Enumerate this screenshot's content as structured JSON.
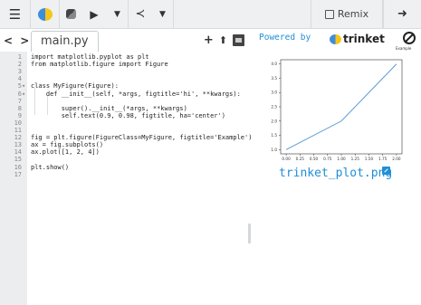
{
  "toolbar": {
    "menu_icon": "menu-icon",
    "run_icon": "run-icon",
    "remix_label": "Remix"
  },
  "editor": {
    "file_tab": "main.py",
    "nav_arrows": "< >",
    "lines": [
      {
        "n": "1",
        "fold": "",
        "code": "import matplotlib.pyplot as plt"
      },
      {
        "n": "2",
        "fold": "",
        "code": "from matplotlib.figure import Figure"
      },
      {
        "n": "3",
        "fold": "",
        "code": ""
      },
      {
        "n": "4",
        "fold": "",
        "code": ""
      },
      {
        "n": "5",
        "fold": "▾",
        "code": "class MyFigure(Figure):"
      },
      {
        "n": "6",
        "fold": "▾",
        "code": "    def __init__(self, *args, figtitle='hi', **kwargs):"
      },
      {
        "n": "7",
        "fold": "",
        "code": ""
      },
      {
        "n": "8",
        "fold": "",
        "code": "        super().__init__(*args, **kwargs)"
      },
      {
        "n": "9",
        "fold": "",
        "code": "        self.text(0.9, 0.98, figtitle, ha='center')"
      },
      {
        "n": "10",
        "fold": "",
        "code": ""
      },
      {
        "n": "11",
        "fold": "",
        "code": ""
      },
      {
        "n": "12",
        "fold": "",
        "code": "fig = plt.figure(FigureClass=MyFigure, figtitle='Example')"
      },
      {
        "n": "13",
        "fold": "",
        "code": "ax = fig.subplots()"
      },
      {
        "n": "14",
        "fold": "",
        "code": "ax.plot([1, 2, 4])"
      },
      {
        "n": "15",
        "fold": "",
        "code": ""
      },
      {
        "n": "16",
        "fold": "",
        "code": "plt.show()"
      },
      {
        "n": "17",
        "fold": "",
        "code": ""
      }
    ]
  },
  "output": {
    "powered_by": "Powered by",
    "brand": "trinket",
    "stop_label": "Example",
    "image_name": "trinket_plot.png"
  },
  "chart_data": {
    "type": "line",
    "x": [
      0,
      1,
      2
    ],
    "y": [
      1,
      2,
      4
    ],
    "xticks": [
      "0.00",
      "0.25",
      "0.50",
      "0.75",
      "1.00",
      "1.25",
      "1.50",
      "1.75",
      "2.00"
    ],
    "yticks": [
      "1.0",
      "1.5",
      "2.0",
      "2.5",
      "3.0",
      "3.5",
      "4.0"
    ],
    "xlim": [
      -0.1,
      2.1
    ],
    "ylim": [
      0.85,
      4.15
    ],
    "line_color": "#5b9bd5",
    "title": "",
    "xlabel": "",
    "ylabel": ""
  },
  "colors": {
    "accent": "#1f8fd6",
    "toolbar_bg": "#eef0f2",
    "gutter_bg": "#ebedef"
  }
}
